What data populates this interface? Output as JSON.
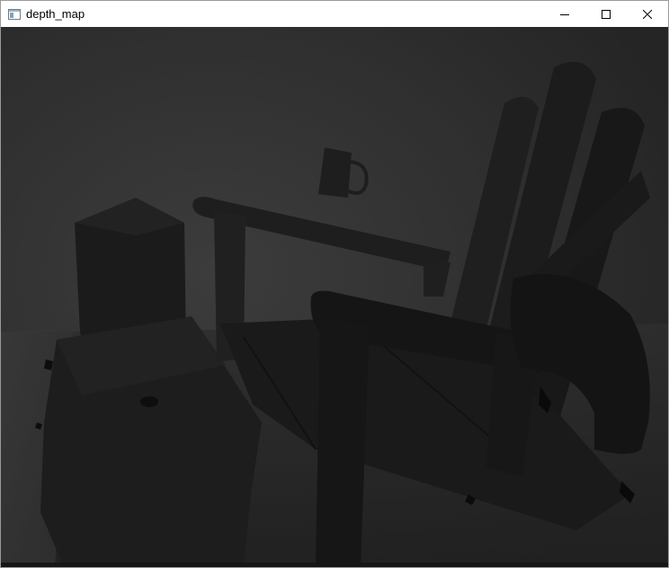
{
  "window": {
    "title": "depth_map",
    "icons": {
      "app": "app-window-icon",
      "minimize": "minimize-icon",
      "maximize": "maximize-icon",
      "close": "close-icon"
    },
    "colors": {
      "titlebar_bg": "#ffffff",
      "title_text": "#000000",
      "client_bg": "#2a2a2a"
    }
  },
  "image": {
    "kind": "grayscale depth map",
    "objects": [
      "cylinder",
      "box",
      "chair",
      "cup"
    ],
    "colors": {
      "far": "#3a3a3a",
      "mid": "#2b2b2b",
      "near": "#1c1c1c",
      "nearest": "#151515",
      "holes": "#000000"
    }
  }
}
